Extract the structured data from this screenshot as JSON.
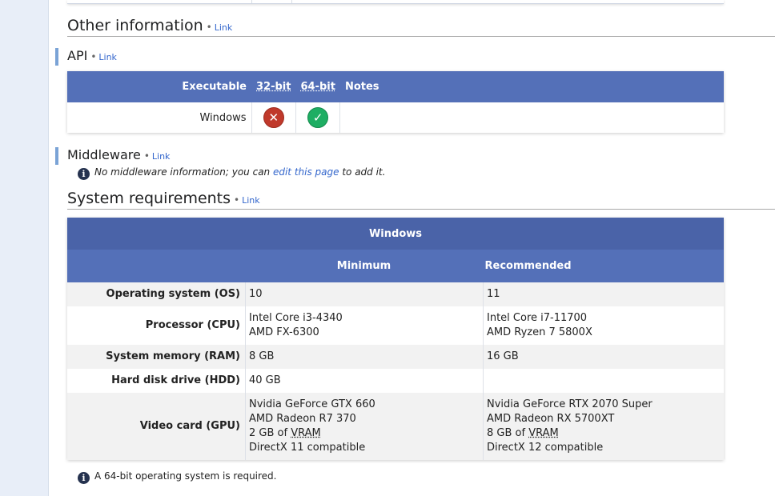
{
  "sections": {
    "other": {
      "title": "Other information",
      "link": "Link"
    },
    "api": {
      "title": "API",
      "link": "Link"
    },
    "middleware": {
      "title": "Middleware",
      "link": "Link"
    },
    "sysreq": {
      "title": "System requirements",
      "link": "Link"
    }
  },
  "api_table": {
    "headers": [
      "Executable",
      "32-bit",
      "64-bit",
      "Notes"
    ],
    "rows": [
      {
        "label": "Windows",
        "32bit": "unsupported",
        "64bit": "supported",
        "notes": ""
      }
    ]
  },
  "middleware_note": {
    "before": "No middleware information; you can ",
    "link": "edit this page",
    "after": " to add it."
  },
  "sysreq_table": {
    "os": "Windows",
    "col_min": "Minimum",
    "col_rec": "Recommended",
    "rows": [
      {
        "label": "Operating system (OS)",
        "min": [
          "10"
        ],
        "rec": [
          "11"
        ]
      },
      {
        "label": "Processor (CPU)",
        "min": [
          "Intel Core i3-4340",
          "AMD FX-6300"
        ],
        "rec": [
          "Intel Core i7-11700",
          "AMD Ryzen 7 5800X"
        ]
      },
      {
        "label": "System memory (RAM)",
        "min": [
          "8 GB"
        ],
        "rec": [
          "16 GB"
        ]
      },
      {
        "label": "Hard disk drive (HDD)",
        "min": [
          "40 GB"
        ],
        "rec": []
      },
      {
        "label": "Video card (GPU)",
        "min": [
          "Nvidia GeForce GTX 660",
          "AMD Radeon R7 370",
          "2 GB of VRAM",
          "DirectX 11 compatible"
        ],
        "rec": [
          "Nvidia GeForce RTX 2070 Super",
          "AMD Radeon RX 5700XT",
          "8 GB of VRAM",
          "DirectX 12 compatible"
        ]
      }
    ]
  },
  "footer_note": "A 64-bit operating system is required.",
  "icons": {
    "unsupported": "x-circle-icon",
    "supported": "check-circle-icon",
    "info": "info-icon"
  },
  "colors": {
    "header_dark": "#4a63a8",
    "header": "#5470b8",
    "link": "#3366cc",
    "x": "#c0392b",
    "check": "#1eae63"
  }
}
